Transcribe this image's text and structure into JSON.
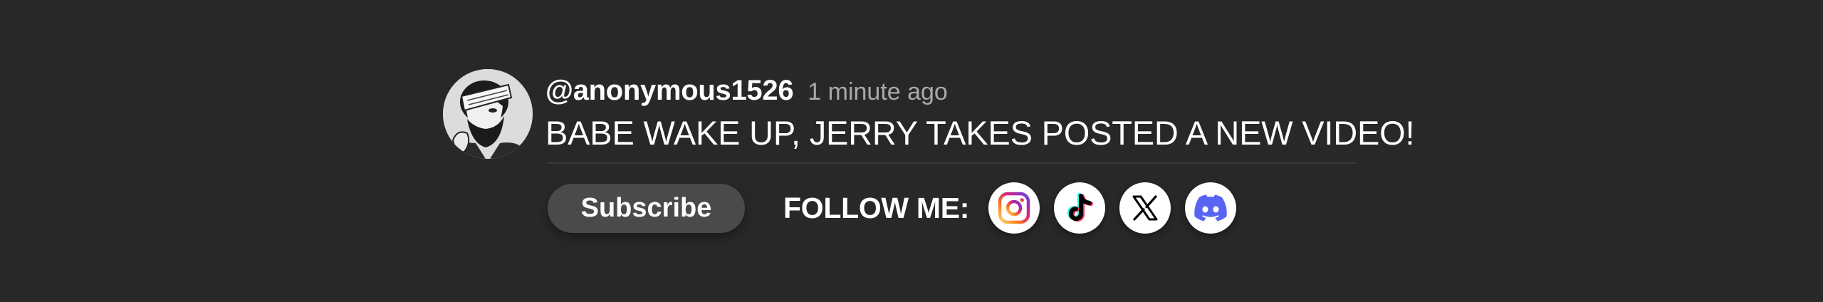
{
  "comment": {
    "username": "@anonymous1526",
    "timestamp": "1 minute ago",
    "text": "BABE WAKE UP, JERRY TAKES POSTED A NEW VIDEO!"
  },
  "actions": {
    "subscribe_label": "Subscribe",
    "follow_label": "FOLLOW ME:"
  },
  "social_links": [
    {
      "name": "instagram",
      "icon": "instagram-icon"
    },
    {
      "name": "tiktok",
      "icon": "tiktok-icon"
    },
    {
      "name": "x",
      "icon": "x-icon"
    },
    {
      "name": "discord",
      "icon": "discord-icon"
    }
  ],
  "colors": {
    "background": "#282828",
    "username": "#ffffff",
    "timestamp": "#aaaaaa",
    "subscribe_bg": "#4a4a4a",
    "discord": "#5865f2",
    "instagram_gradient": [
      "#feda75",
      "#fa7e1e",
      "#d62976",
      "#962fbf",
      "#4f5bd5"
    ]
  }
}
